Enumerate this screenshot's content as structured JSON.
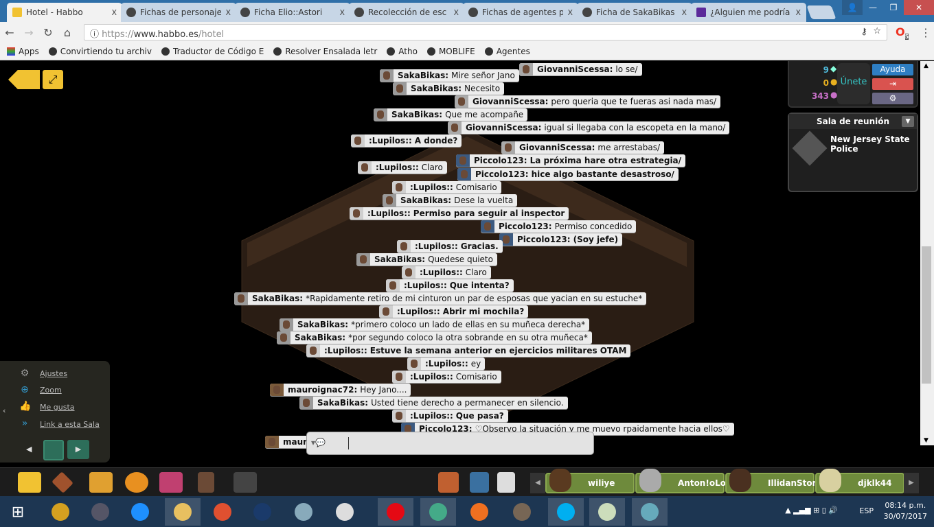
{
  "browser": {
    "tabs": [
      {
        "label": "Hotel - Habbo",
        "active": true
      },
      {
        "label": "Fichas de personaje"
      },
      {
        "label": "Ficha Elio::Astori"
      },
      {
        "label": "Recolección de esc"
      },
      {
        "label": "Fichas de agentes p"
      },
      {
        "label": "Ficha de SakaBikas"
      },
      {
        "label": "¿Alguien me podría"
      }
    ],
    "tab_close": "X",
    "url_scheme": "https://",
    "url_host": "www.habbo.es",
    "url_path": "/hotel",
    "extension_badge": "5",
    "bookmarks": [
      "Apps",
      "Convirtiendo tu archiv",
      "Traductor de Código E",
      "Resolver Ensalada letr",
      "Atho",
      "MOBLIFE",
      "Agentes"
    ]
  },
  "hud": {
    "diamonds": "9",
    "credits": "0",
    "duckets": "343",
    "join_label": "Únete",
    "help_label": "Ayuda",
    "room_panel_title": "Sala de reunión",
    "room_name": "New Jersey State Police"
  },
  "chat": [
    {
      "user": "SakaBikas:",
      "msg": "Mire señor Jano"
    },
    {
      "user": "GiovanniScessa:",
      "msg": "lo se/"
    },
    {
      "user": "SakaBikas:",
      "msg": "Necesito"
    },
    {
      "user": "GiovanniScessa:",
      "msg": "pero queria que te fueras asi nada mas/"
    },
    {
      "user": "SakaBikas:",
      "msg": "Que me acompañe"
    },
    {
      "user": "GiovanniScessa:",
      "msg": "igual si llegaba con la escopeta en la mano/"
    },
    {
      "user": ":Lupilos::",
      "msg": "A donde?"
    },
    {
      "user": "GiovanniScessa:",
      "msg": "me arrestabas/"
    },
    {
      "user": "Piccolo123:",
      "msg": "La próxima hare otra estrategia/"
    },
    {
      "user": ":Lupilos::",
      "msg": "Claro"
    },
    {
      "user": "Piccolo123:",
      "msg": "hice algo bastante desastroso/"
    },
    {
      "user": ":Lupilos::",
      "msg": "Comisario"
    },
    {
      "user": "SakaBikas:",
      "msg": "Dese la vuelta"
    },
    {
      "user": ":Lupilos::",
      "msg": "Permiso para seguir al inspector"
    },
    {
      "user": "Piccolo123:",
      "msg": "Permiso concedido"
    },
    {
      "user": "Piccolo123:",
      "msg": "(Soy jefe)"
    },
    {
      "user": ":Lupilos::",
      "msg": "Gracias."
    },
    {
      "user": "SakaBikas:",
      "msg": "Quedese quieto"
    },
    {
      "user": ":Lupilos::",
      "msg": "Claro"
    },
    {
      "user": ":Lupilos::",
      "msg": "Que intenta?"
    },
    {
      "user": "SakaBikas:",
      "msg": "*Rapidamente retiro de mi cinturon un par de esposas que yacian en su estuche*"
    },
    {
      "user": ":Lupilos::",
      "msg": "Abrir mi mochila?"
    },
    {
      "user": "SakaBikas:",
      "msg": "*primero coloco un lado de ellas en su muñeca derecha*"
    },
    {
      "user": "SakaBikas:",
      "msg": "*por segundo coloco la otra sobrande en su otra muñeca*"
    },
    {
      "user": ":Lupilos::",
      "msg": "Estuve la semana anterior en ejercicios militares OTAM"
    },
    {
      "user": ":Lupilos::",
      "msg": "ey"
    },
    {
      "user": ":Lupilos::",
      "msg": "Comisario"
    },
    {
      "user": "mauroignac72:",
      "msg": "Hey Jano...."
    },
    {
      "user": "SakaBikas:",
      "msg": "Usted tiene derecho a permanecer en silencio."
    },
    {
      "user": ":Lupilos::",
      "msg": "Que pasa?"
    },
    {
      "user": "Piccolo123:",
      "msg": "♡Observo la situación y me muevo rpaidamente hacia ellos♡"
    },
    {
      "user": "maur",
      "msg": ""
    }
  ],
  "room_menu": [
    "Ajustes",
    "Zoom",
    "Me gusta",
    "Link a esta Sala"
  ],
  "friends": [
    "wiliye",
    "Anton!oLoko",
    "IllidanStormra",
    "djklk44"
  ],
  "taskbar": {
    "lang": "ESP",
    "time": "08:14 p.m.",
    "date": "30/07/2017"
  },
  "colors": {
    "tabbar": "#2f6fa8",
    "help": "#2e7ec2",
    "logout": "#d9534f",
    "settings": "#6a6784",
    "friend": "#6e8a3c"
  }
}
